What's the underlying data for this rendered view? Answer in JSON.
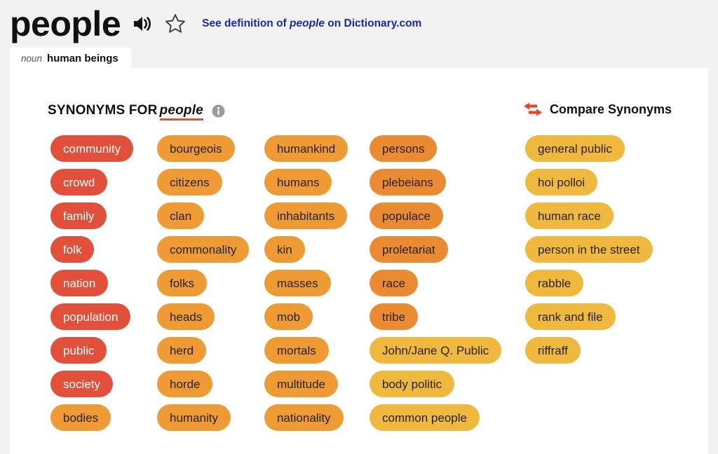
{
  "header": {
    "headword": "people",
    "audio_icon": "speaker-icon",
    "favorite_icon": "star-icon",
    "definition_link": {
      "prefix": "See definition of ",
      "word": "people",
      "suffix": " on Dictionary.com"
    }
  },
  "tab": {
    "part_of_speech": "noun",
    "sense": "human beings"
  },
  "section": {
    "title_prefix": "SYNONYMS FOR",
    "title_word": "people",
    "info_icon": "info-icon",
    "compare_label": "Compare Synonyms",
    "compare_icon": "compare-arrows-icon"
  },
  "colors": {
    "strongest": "#e0503a",
    "strong": "#ea8b33",
    "medium": "#ee9b35",
    "light": "#efb93f",
    "link": "#1a29a8",
    "page_bg": "#f2f2f2",
    "card_bg": "#ffffff"
  },
  "synonym_columns": [
    {
      "column": 1,
      "chips": [
        {
          "label": "community",
          "tier": "t3"
        },
        {
          "label": "crowd",
          "tier": "t3"
        },
        {
          "label": "family",
          "tier": "t3"
        },
        {
          "label": "folk",
          "tier": "t3"
        },
        {
          "label": "nation",
          "tier": "t3"
        },
        {
          "label": "population",
          "tier": "t3"
        },
        {
          "label": "public",
          "tier": "t3"
        },
        {
          "label": "society",
          "tier": "t3"
        },
        {
          "label": "bodies",
          "tier": "t1"
        }
      ]
    },
    {
      "column": 2,
      "chips": [
        {
          "label": "bourgeois",
          "tier": "t1"
        },
        {
          "label": "citizens",
          "tier": "t1"
        },
        {
          "label": "clan",
          "tier": "t1"
        },
        {
          "label": "commonality",
          "tier": "t1"
        },
        {
          "label": "folks",
          "tier": "t1"
        },
        {
          "label": "heads",
          "tier": "t1"
        },
        {
          "label": "herd",
          "tier": "t1"
        },
        {
          "label": "horde",
          "tier": "t1"
        },
        {
          "label": "humanity",
          "tier": "t1"
        }
      ]
    },
    {
      "column": 3,
      "chips": [
        {
          "label": "humankind",
          "tier": "t1"
        },
        {
          "label": "humans",
          "tier": "t1"
        },
        {
          "label": "inhabitants",
          "tier": "t1"
        },
        {
          "label": "kin",
          "tier": "t1"
        },
        {
          "label": "masses",
          "tier": "t1"
        },
        {
          "label": "mob",
          "tier": "t1"
        },
        {
          "label": "mortals",
          "tier": "t1"
        },
        {
          "label": "multitude",
          "tier": "t1"
        },
        {
          "label": "nationality",
          "tier": "t1"
        }
      ]
    },
    {
      "column": 4,
      "chips": [
        {
          "label": "persons",
          "tier": "t2"
        },
        {
          "label": "plebeians",
          "tier": "t2"
        },
        {
          "label": "populace",
          "tier": "t2"
        },
        {
          "label": "proletariat",
          "tier": "t2"
        },
        {
          "label": "race",
          "tier": "t2"
        },
        {
          "label": "tribe",
          "tier": "t2"
        },
        {
          "label": "John/Jane Q. Public",
          "tier": "t0"
        },
        {
          "label": "body politic",
          "tier": "t0"
        },
        {
          "label": "common people",
          "tier": "t0"
        }
      ]
    },
    {
      "column": 5,
      "chips": [
        {
          "label": "general public",
          "tier": "t0"
        },
        {
          "label": "hoi polloi",
          "tier": "t0"
        },
        {
          "label": "human race",
          "tier": "t0"
        },
        {
          "label": "person in the street",
          "tier": "t0"
        },
        {
          "label": "rabble",
          "tier": "t0"
        },
        {
          "label": "rank and file",
          "tier": "t0"
        },
        {
          "label": "riffraff",
          "tier": "t0"
        }
      ]
    }
  ]
}
